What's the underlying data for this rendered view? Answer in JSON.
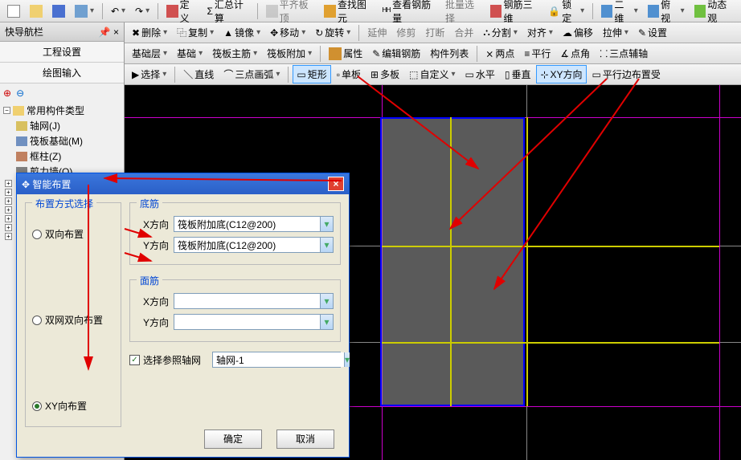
{
  "topbar": {
    "items": [
      "定义",
      "汇总计算",
      "平齐板顶",
      "查找图元",
      "查看钢筋量",
      "批量选择",
      "钢筋三维",
      "锁定",
      "二维",
      "俯视",
      "动态观"
    ]
  },
  "nav": {
    "title": "快导航栏",
    "tab1": "工程设置",
    "tab2": "绘图输入",
    "tree_root": "常用构件类型",
    "nodes": [
      {
        "ico": "#d8c060",
        "label": "轴网(J)"
      },
      {
        "ico": "#7090c0",
        "label": "筏板基础(M)"
      },
      {
        "ico": "#c08060",
        "label": "框柱(Z)"
      },
      {
        "ico": "#808080",
        "label": "剪力墙(Q)"
      }
    ]
  },
  "tb1": {
    "items": [
      "删除",
      "复制",
      "镜像",
      "移动",
      "旋转",
      "延伸",
      "修剪",
      "打断",
      "合并",
      "分割",
      "对齐",
      "偏移",
      "拉伸",
      "设置"
    ]
  },
  "tb2": {
    "layer": "基础层",
    "comp": "基础",
    "rebar": "筏板主筋",
    "extra": "筏板附加",
    "items": [
      "属性",
      "编辑钢筋",
      "构件列表",
      "两点",
      "平行",
      "点角",
      "三点辅轴"
    ]
  },
  "tb3": {
    "sel": "选择",
    "line": "直线",
    "arc": "三点画弧",
    "rect": "矩形",
    "single": "单板",
    "multi": "多板",
    "custom": "自定义",
    "horiz": "水平",
    "vert": "垂直",
    "xy": "XY方向",
    "edge": "平行边布置受"
  },
  "dialog": {
    "title": "智能布置",
    "group_mode": "布置方式选择",
    "r1": "双向布置",
    "r2": "双网双向布置",
    "r3": "XY向布置",
    "group_bottom": "底筋",
    "group_top": "面筋",
    "xdir": "X方向",
    "ydir": "Y方向",
    "bottom_x": "筏板附加底(C12@200)",
    "bottom_y": "筏板附加底(C12@200)",
    "top_x": "",
    "top_y": "",
    "ref_chk": "选择参照轴网",
    "ref_val": "轴网-1",
    "ok": "确定",
    "cancel": "取消"
  }
}
